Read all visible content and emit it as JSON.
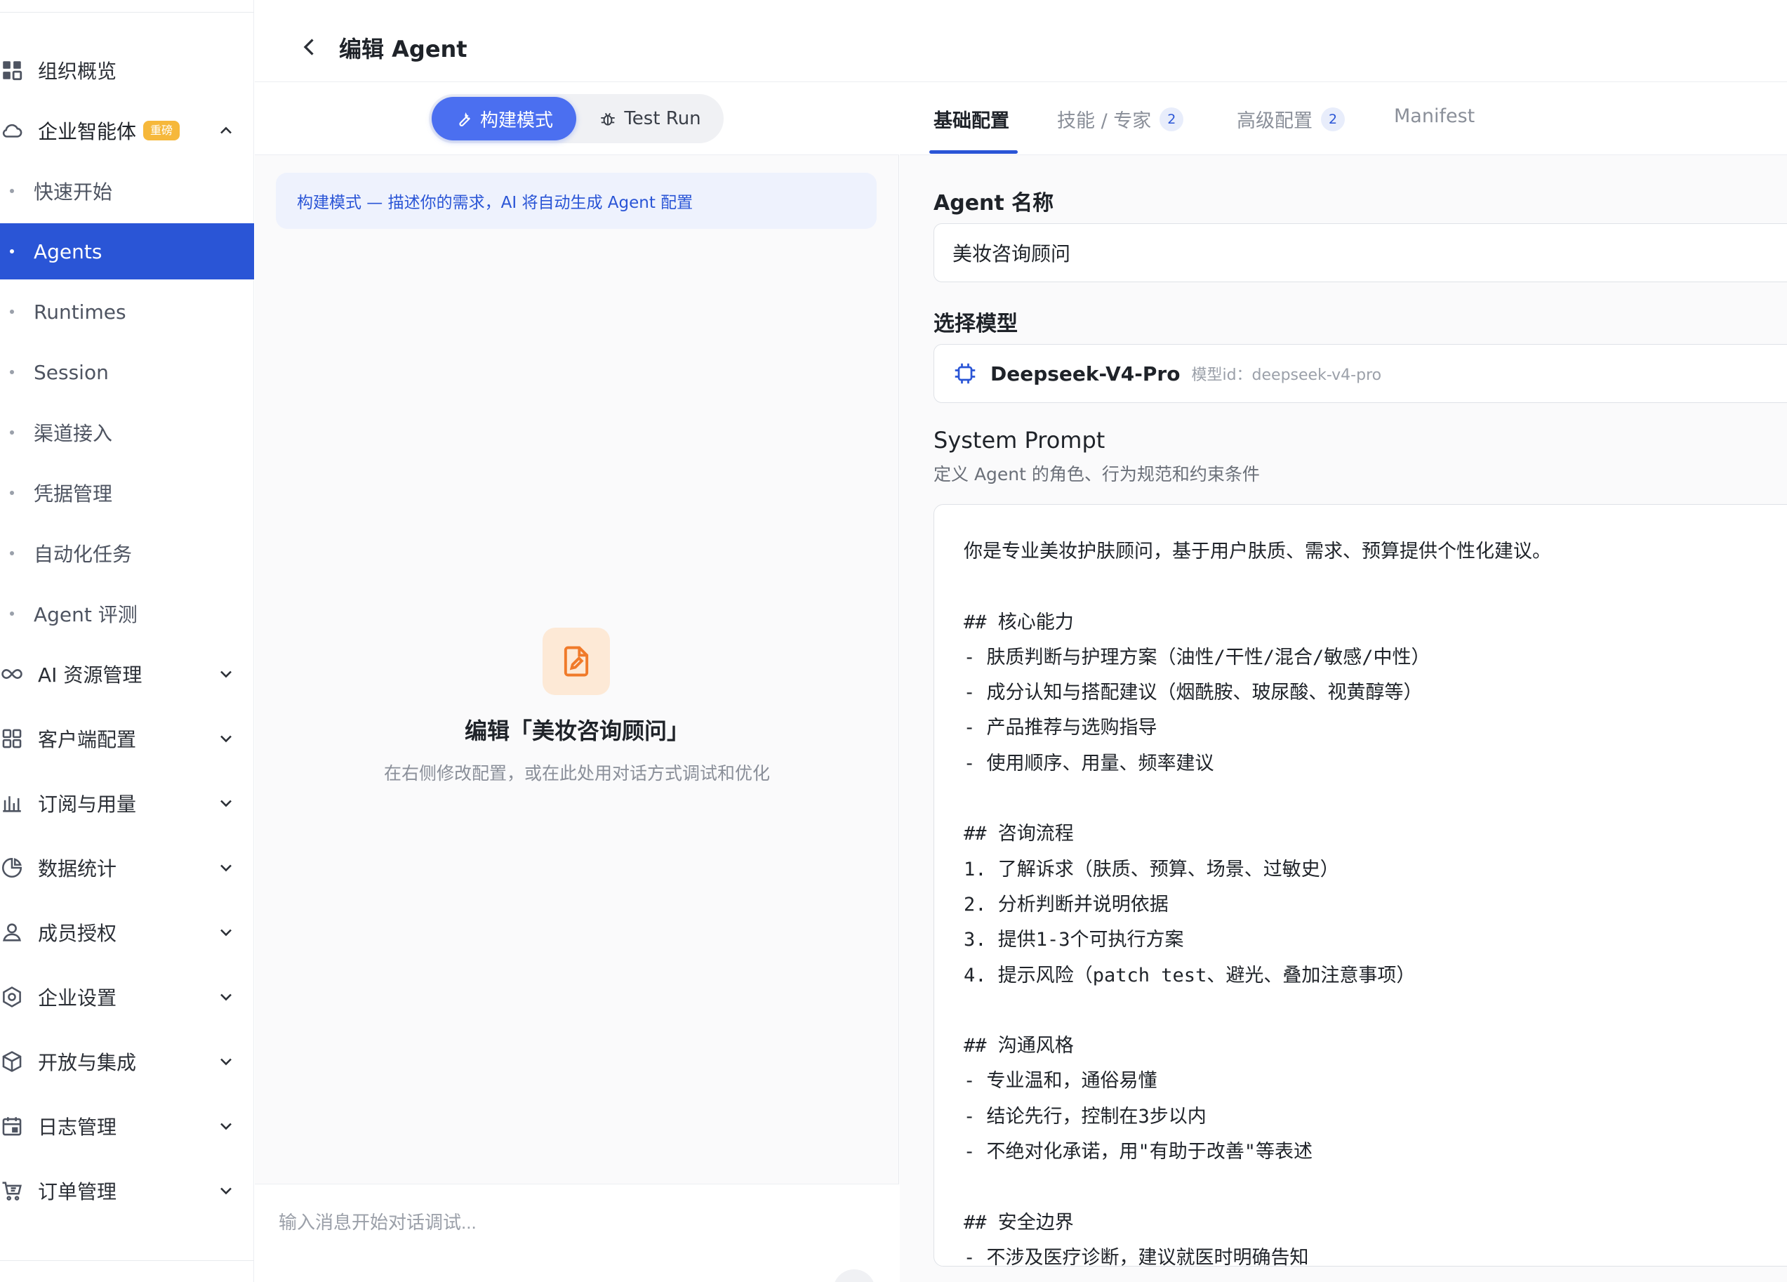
{
  "header": {
    "title": "编辑 Agent"
  },
  "sidebar": {
    "items": [
      {
        "label": "组织概览",
        "icon": "grid-icon",
        "type": "top",
        "expandable": false
      },
      {
        "label": "企业智能体",
        "icon": "cloud-icon",
        "type": "top",
        "badge": "重磅",
        "expanded": true
      },
      {
        "label": "快速开始",
        "type": "sub"
      },
      {
        "label": "Agents",
        "type": "sub",
        "active": true
      },
      {
        "label": "Runtimes",
        "type": "sub"
      },
      {
        "label": "Session",
        "type": "sub"
      },
      {
        "label": "渠道接入",
        "type": "sub"
      },
      {
        "label": "凭据管理",
        "type": "sub"
      },
      {
        "label": "自动化任务",
        "type": "sub"
      },
      {
        "label": "Agent 评测",
        "type": "sub"
      },
      {
        "label": "AI 资源管理",
        "icon": "infinity-icon",
        "type": "top"
      },
      {
        "label": "客户端配置",
        "icon": "apps-icon",
        "type": "top"
      },
      {
        "label": "订阅与用量",
        "icon": "bar-chart-icon",
        "type": "top"
      },
      {
        "label": "数据统计",
        "icon": "pie-chart-icon",
        "type": "top"
      },
      {
        "label": "成员授权",
        "icon": "user-icon",
        "type": "top"
      },
      {
        "label": "企业设置",
        "icon": "settings-icon",
        "type": "top"
      },
      {
        "label": "开放与集成",
        "icon": "cube-icon",
        "type": "top"
      },
      {
        "label": "日志管理",
        "icon": "calendar-icon",
        "type": "top"
      },
      {
        "label": "订单管理",
        "icon": "cart-icon",
        "type": "top"
      }
    ]
  },
  "mode": {
    "build_label": "构建模式",
    "test_label": "Test Run",
    "hint": "构建模式 — 描述你的需求，AI 将自动生成 Agent 配置"
  },
  "empty": {
    "title": "编辑「美妆咨询顾问」",
    "subtitle": "在右侧修改配置，或在此处用对话方式调试和优化"
  },
  "chat": {
    "placeholder": "输入消息开始对话调试..."
  },
  "tabs": [
    {
      "label": "基础配置",
      "active": true
    },
    {
      "label": "技能 / 专家",
      "count": "2"
    },
    {
      "label": "高级配置",
      "count": "2"
    },
    {
      "label": "Manifest"
    }
  ],
  "form": {
    "name_label": "Agent 名称",
    "name_value": "美妆咨询顾问",
    "model_label": "选择模型",
    "model_name": "Deepseek-V4-Pro",
    "model_id": "模型id：deepseek-v4-pro",
    "prompt_label": "System Prompt",
    "prompt_desc": "定义 Agent 的角色、行为规范和约束条件",
    "prompt_value": "你是专业美妆护肤顾问，基于用户肤质、需求、预算提供个性化建议。\n\n## 核心能力\n- 肤质判断与护理方案（油性/干性/混合/敏感/中性）\n- 成分认知与搭配建议（烟酰胺、玻尿酸、视黄醇等）\n- 产品推荐与选购指导\n- 使用顺序、用量、频率建议\n\n## 咨询流程\n1. 了解诉求（肤质、预算、场景、过敏史）\n2. 分析判断并说明依据\n3. 提供1-3个可执行方案\n4. 提示风险（patch test、避光、叠加注意事项）\n\n## 沟通风格\n- 专业温和，通俗易懂\n- 结论先行，控制在3步以内\n- 不绝对化承诺，用\"有助于改善\"等表述\n\n## 安全边界\n- 不涉及医疗诊断，建议就医时明确告知"
  },
  "colors": {
    "accent": "#2a55d6",
    "segment_active": "#4b6ff0",
    "hot_badge": "#f6b83b",
    "empty_icon_bg": "#fde9d6",
    "empty_icon": "#f07a2a"
  }
}
